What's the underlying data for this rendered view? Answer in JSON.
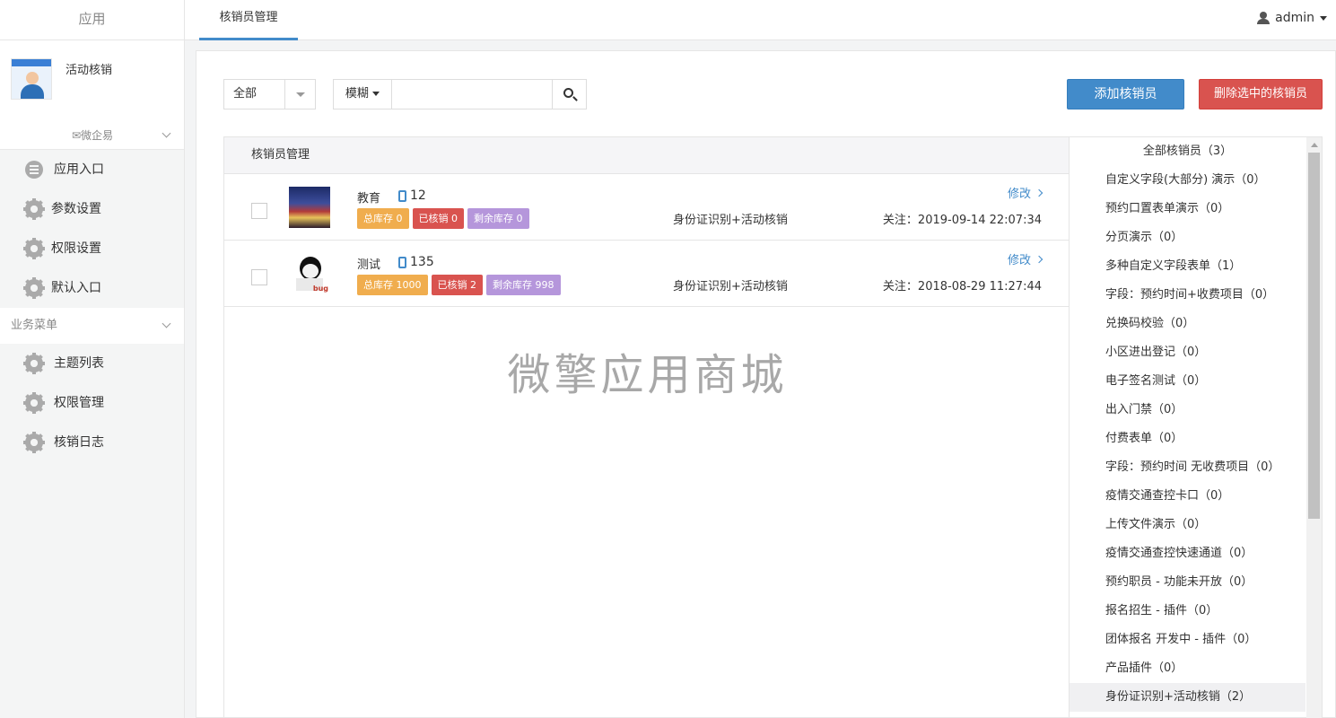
{
  "topbar": {
    "brand": "应用",
    "active_tab": "核销员管理",
    "user": "admin"
  },
  "sidebar": {
    "app_title": "活动核销",
    "wx_label": "微企易",
    "items_top": [
      {
        "label": "应用入口",
        "icon": "chat-icon"
      },
      {
        "label": "参数设置",
        "icon": "gear-icon"
      },
      {
        "label": "权限设置",
        "icon": "gear-icon"
      },
      {
        "label": "默认入口",
        "icon": "gear-icon"
      }
    ],
    "group_label": "业务菜单",
    "items_biz": [
      {
        "label": "主题列表",
        "icon": "gear-icon"
      },
      {
        "label": "权限管理",
        "icon": "gear-icon"
      },
      {
        "label": "核销日志",
        "icon": "gear-icon"
      }
    ]
  },
  "toolbar": {
    "filter_value": "全部",
    "mode_label": "模糊",
    "search_value": "",
    "add_label": "添加核销员",
    "delete_label": "删除选中的核销员"
  },
  "list": {
    "header": "核销员管理",
    "rows": [
      {
        "name": "教育",
        "phone": "12",
        "badges": [
          "总库存 0",
          "已核销 0",
          "剩余库存 0"
        ],
        "category": "身份证识别+活动核销",
        "edit": "修改",
        "follow": "关注：2019-09-14 22:07:34"
      },
      {
        "name": "测试",
        "phone": "135",
        "badges": [
          "总库存 1000",
          "已核销 2",
          "剩余库存 998"
        ],
        "category": "身份证识别+活动核销",
        "edit": "修改",
        "follow": "关注：2018-08-29 11:27:44"
      }
    ],
    "watermark": "微擎应用商城"
  },
  "categories": [
    "全部核销员（3）",
    "自定义字段(大部分) 演示（0）",
    "预约口置表单演示（0）",
    "分页演示（0）",
    "多种自定义字段表单（1）",
    "字段：预约时间+收费项目（0）",
    "兑换码校验（0）",
    "小区进出登记（0）",
    "电子签名测试（0）",
    "出入门禁（0）",
    "付费表单（0）",
    "字段：预约时间 无收费项目（0）",
    "疫情交通查控卡口（0）",
    "上传文件演示（0）",
    "疫情交通查控快速通道（0）",
    "预约职员 - 功能未开放（0）",
    "报名招生 - 插件（0）",
    "团体报名 开发中 - 插件（0）",
    "产品插件（0）",
    "身份证识别+活动核销（2）"
  ],
  "colors": {
    "primary": "#428bca",
    "danger": "#d9534f",
    "warning": "#f0ad4e",
    "purple": "#b596db"
  }
}
